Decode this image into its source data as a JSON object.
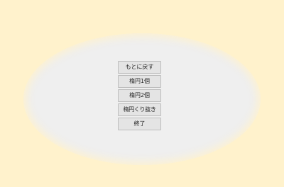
{
  "menu": {
    "restore_label": "もとに戻す",
    "ellipse1_label": "楕円1個",
    "ellipse2_label": "楕円2個",
    "ellipse_cutout_label": "楕円くり抜き",
    "exit_label": "終了"
  }
}
